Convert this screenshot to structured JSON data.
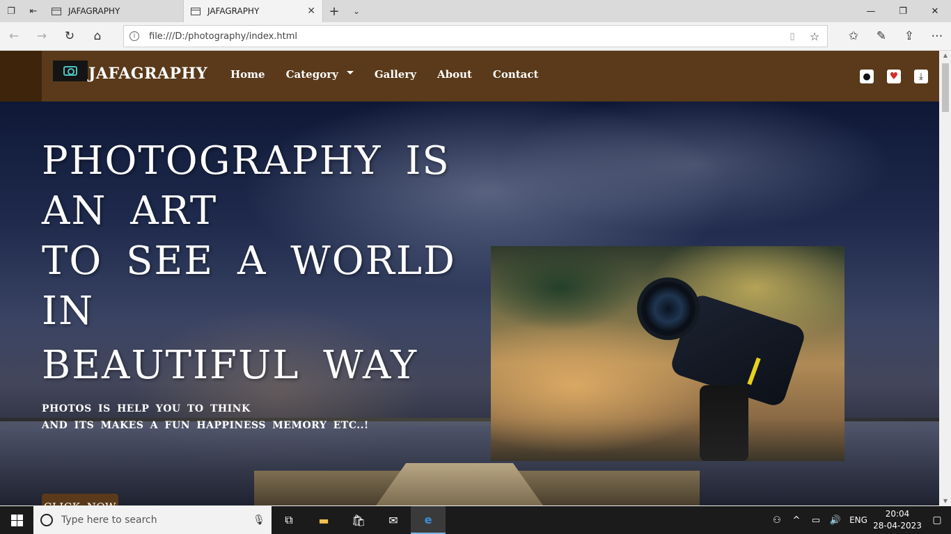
{
  "browser": {
    "tabs": [
      {
        "title": "JAFAGRAPHY",
        "active": false
      },
      {
        "title": "JAFAGRAPHY",
        "active": true
      }
    ],
    "url": "file:///D:/photography/index.html"
  },
  "site": {
    "brand": "JAFAGRAPHY",
    "nav": {
      "home": "Home",
      "category": "Category",
      "gallery": "Gallery",
      "about": "About",
      "contact": "Contact"
    },
    "hero": {
      "title_lines": [
        "PHOTOGRAPHY IS",
        "AN ART",
        "TO SEE A WORLD",
        "IN",
        "BEAUTIFUL WAY"
      ],
      "subtitle_lines": [
        "PHOTOS IS HELP YOU TO THINK",
        "AND ITS MAKES A FUN HAPPINESS MEMORY ETC..!"
      ],
      "cta": "CLICK NOW"
    },
    "colors": {
      "header": "#5a3a1a",
      "header_left": "#3e240b",
      "cta": "#5a3a1a"
    }
  },
  "taskbar": {
    "search_placeholder": "Type here to search",
    "language": "ENG",
    "time": "20:04",
    "date": "28-04-2023"
  }
}
